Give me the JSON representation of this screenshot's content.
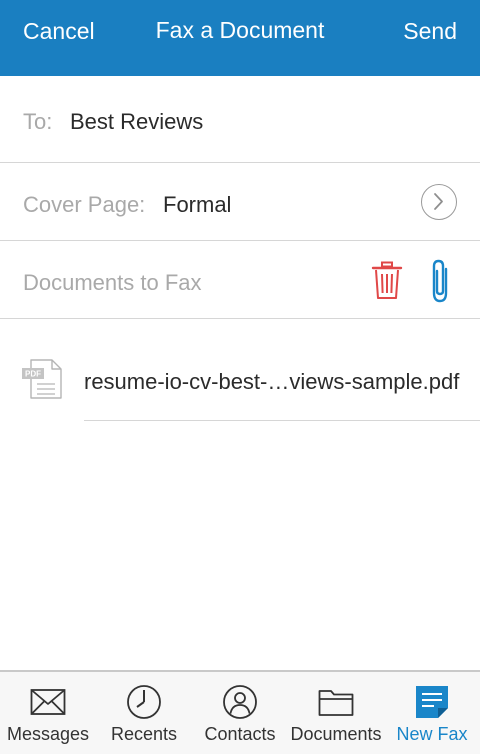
{
  "colors": {
    "header_bg": "#1a7fc1",
    "accent": "#1a86c9",
    "delete": "#e04848",
    "label_gray": "#a9a9a9"
  },
  "header": {
    "cancel_label": "Cancel",
    "title": "Fax a Document",
    "send_label": "Send"
  },
  "form": {
    "to_label": "To:",
    "to_value": "Best Reviews",
    "cover_label": "Cover Page:",
    "cover_value": "Formal",
    "documents_label": "Documents to Fax"
  },
  "documents": [
    {
      "name": "resume-io-cv-best-…views-sample.pdf",
      "icon": "pdf-file-icon",
      "icon_text": "PDF"
    }
  ],
  "tabs": [
    {
      "label": "Messages",
      "icon": "envelope-icon",
      "active": false
    },
    {
      "label": "Recents",
      "icon": "clock-icon",
      "active": false
    },
    {
      "label": "Contacts",
      "icon": "contact-icon",
      "active": false
    },
    {
      "label": "Documents",
      "icon": "folder-icon",
      "active": false
    },
    {
      "label": "New Fax",
      "icon": "new-fax-icon",
      "active": true
    }
  ]
}
